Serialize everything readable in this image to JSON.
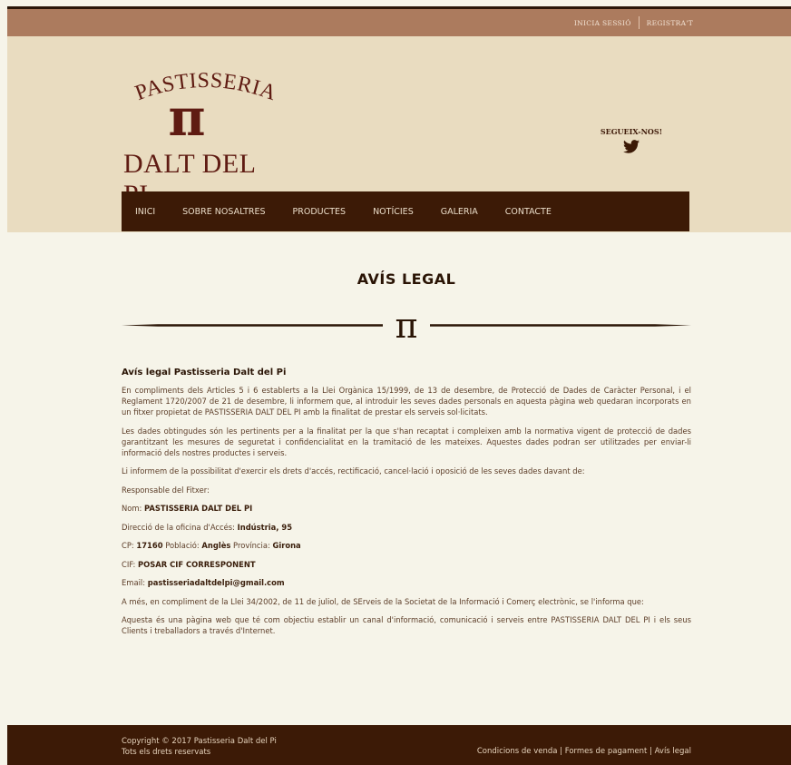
{
  "topbar": {
    "login": "INICIA SESSIÓ",
    "register": "REGISTRA'T"
  },
  "logo": {
    "top": "PASTISSERIA",
    "symbol": "π",
    "bottom": "DALT DEL PI"
  },
  "social": {
    "label": "SEGUEIX-NOS!",
    "icon": "twitter-icon"
  },
  "nav": {
    "items": [
      "INICI",
      "SOBRE NOSALTRES",
      "PRODUCTES",
      "NOTÍCIES",
      "GALERIA",
      "CONTACTE"
    ]
  },
  "page": {
    "title": "AVÍS LEGAL",
    "divider_symbol": "π"
  },
  "content": {
    "heading": "Avís legal Pastisseria Dalt del Pi",
    "p1": "En compliments dels Articles 5 i 6 establerts a la Llei Orgànica 15/1999, de 13 de desembre, de Protecció de Dades de Caràcter Personal, i el Reglament 1720/2007 de 21 de desembre, li informem que, al introduir les seves dades personals en aquesta pàgina web quedaran incorporats en un fitxer propietat de PASTISSERIA DALT DEL PI amb la finalitat de prestar els serveis sol·licitats.",
    "p2": "Les dades obtingudes són les pertinents per a la finalitat per la que s'han recaptat i compleixen amb la normativa vigent de protecció de dades garantitzant les mesures de seguretat i confidencialitat en la tramitació de les mateixes. Aquestes dades podran ser utilitzades per enviar-li informació dels nostres productes i serveis.",
    "p3": "Li informem de la possibilitat d'exercir els drets d'accés, rectificació, cancel·lació i oposició de les seves dades davant de:",
    "responsible_label": "Responsable del Fitxer:",
    "name_label": "Nom: ",
    "name_value": "PASTISSERIA DALT DEL PI",
    "office_label": "Direcció de la oficina d'Accés: ",
    "office_value": "Indústria, 95",
    "cp_label": "CP: ",
    "cp_value": "17160",
    "city_label": " Població: ",
    "city_value": "Anglès",
    "province_label": " Província: ",
    "province_value": "Girona",
    "cif_label": "CIF: ",
    "cif_value": "POSAR CIF CORRESPONENT",
    "email_label": "Email: ",
    "email_value": "pastisseriadaltdelpi@gmail.com",
    "p4": "A més, en compliment de la Llei 34/2002, de 11 de juliol, de SErveis de la Societat de la Informació i Comerç electrònic, se l'informa que:",
    "p5": "Aquesta és una pàgina web que té com objectiu establir un canal d'informació, comunicació i serveis entre PASTISSERIA DALT DEL PI i els seus Clients i treballadors a través d'Internet."
  },
  "footer": {
    "copyright": "Copyright © 2017 Pastisseria Dalt del Pi",
    "rights": "Tots els drets reservats",
    "link_sales": "Condicions de venda",
    "link_payment": "Formes de pagament",
    "link_legal": "Avís legal",
    "separator": " | "
  },
  "colors": {
    "topbar": "#ac7b5e",
    "header": "#e9dcc0",
    "nav": "#3c1a06",
    "body": "#f6f4e9",
    "logo": "#5f1b12"
  }
}
